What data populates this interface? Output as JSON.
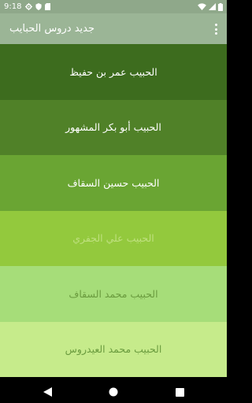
{
  "status_bar": {
    "time": "9:18"
  },
  "app_bar": {
    "title": "جديد دروس الحبايب"
  },
  "list": {
    "items": [
      {
        "label": "الحبيب عمر بن حفيظ",
        "bg": "#3d6c1e",
        "fg": "#ffffff"
      },
      {
        "label": "الحبيب أبو بكر المشهور",
        "bg": "#508128",
        "fg": "#ffffff"
      },
      {
        "label": "الحبيب حسين السقاف",
        "bg": "#6aa533",
        "fg": "#ffffff"
      },
      {
        "label": "الحبيب علي الجفري",
        "bg": "#93c93d",
        "fg": "#bfe07f"
      },
      {
        "label": "الحبيب محمد السقاف",
        "bg": "#a6dd79",
        "fg": "#6b9c3f"
      },
      {
        "label": "الحبيب محمد العيدروس",
        "bg": "#c6eb8b",
        "fg": "#6b9c3f"
      }
    ]
  },
  "colors": {
    "status_bar": "#8fa88a",
    "app_bar": "#9bb596",
    "nav_bar": "#000000"
  }
}
